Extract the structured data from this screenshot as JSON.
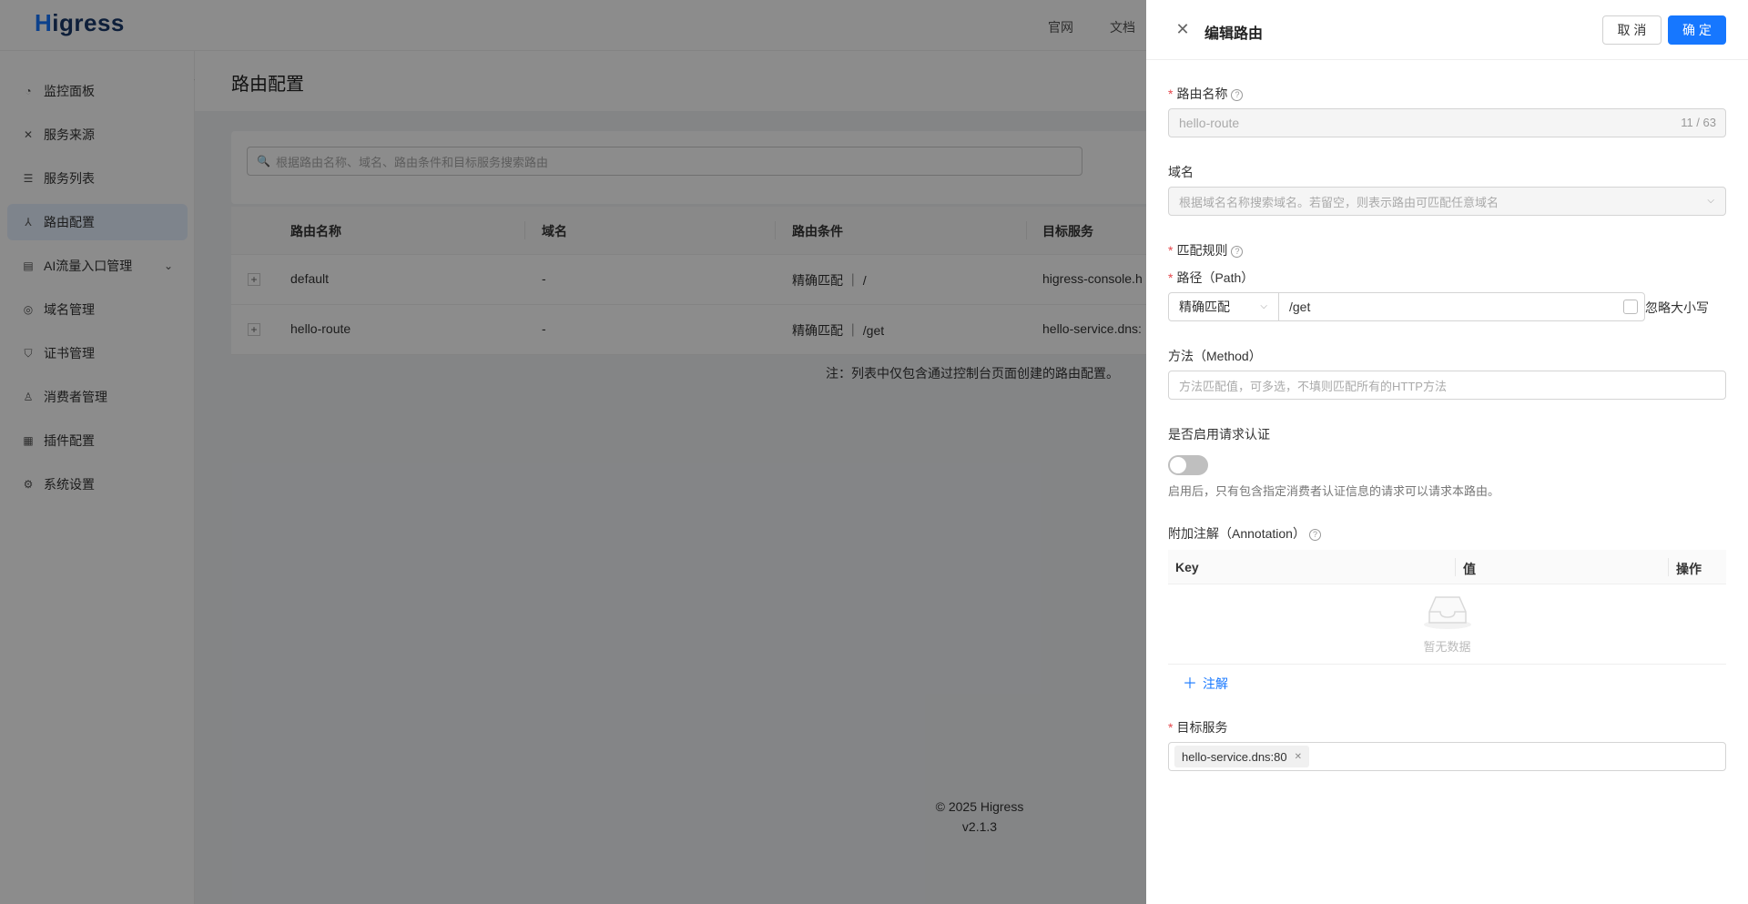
{
  "app": {
    "logo": "Higress",
    "topnav": [
      "官网",
      "文档"
    ]
  },
  "sidebar": {
    "items": [
      {
        "label": "监控面板",
        "icon": "dashboard-icon"
      },
      {
        "label": "服务来源",
        "icon": "service-source-icon"
      },
      {
        "label": "服务列表",
        "icon": "list-icon"
      },
      {
        "label": "路由配置",
        "icon": "route-icon",
        "active": true
      },
      {
        "label": "AI流量入口管理",
        "icon": "ai-gateway-icon",
        "expandable": true
      },
      {
        "label": "域名管理",
        "icon": "globe-icon"
      },
      {
        "label": "证书管理",
        "icon": "shield-icon"
      },
      {
        "label": "消费者管理",
        "icon": "user-icon"
      },
      {
        "label": "插件配置",
        "icon": "plugin-icon"
      },
      {
        "label": "系统设置",
        "icon": "gear-icon"
      }
    ]
  },
  "page": {
    "title": "路由配置",
    "search_placeholder": "根据路由名称、域名、路由条件和目标服务搜索路由",
    "table": {
      "headers": [
        "路由名称",
        "域名",
        "路由条件",
        "目标服务"
      ],
      "rows": [
        {
          "name": "default",
          "domain": "-",
          "condition": "精确匹配 ｜ /",
          "target": "higress-console.h"
        },
        {
          "name": "hello-route",
          "domain": "-",
          "condition": "精确匹配 ｜ /get",
          "target": "hello-service.dns:"
        }
      ]
    },
    "note": "注：列表中仅包含通过控制台页面创建的路由配置。",
    "footer": {
      "copyright": "© 2025 Higress",
      "version": "v2.1.3"
    }
  },
  "drawer": {
    "title": "编辑路由",
    "cancel_label": "取 消",
    "ok_label": "确 定",
    "route_name": {
      "label": "路由名称",
      "value": "hello-route",
      "counter": "11 / 63"
    },
    "domain": {
      "label": "域名",
      "placeholder": "根据域名名称搜索域名。若留空，则表示路由可匹配任意域名"
    },
    "match_rules": {
      "label": "匹配规则"
    },
    "path": {
      "label": "路径（Path）",
      "match_type": "精确匹配",
      "value": "/get",
      "ignore_case_label": "忽略大小写"
    },
    "method": {
      "label": "方法（Method）",
      "placeholder": "方法匹配值，可多选，不填则匹配所有的HTTP方法"
    },
    "auth": {
      "label": "是否启用请求认证",
      "enabled": false,
      "hint": "启用后，只有包含指定消费者认证信息的请求可以请求本路由。"
    },
    "annotation": {
      "label": "附加注解（Annotation）",
      "headers": [
        "Key",
        "值",
        "操作"
      ],
      "empty_text": "暂无数据",
      "add_label": "注解"
    },
    "target_service": {
      "label": "目标服务",
      "tags": [
        "hello-service.dns:80"
      ]
    }
  }
}
